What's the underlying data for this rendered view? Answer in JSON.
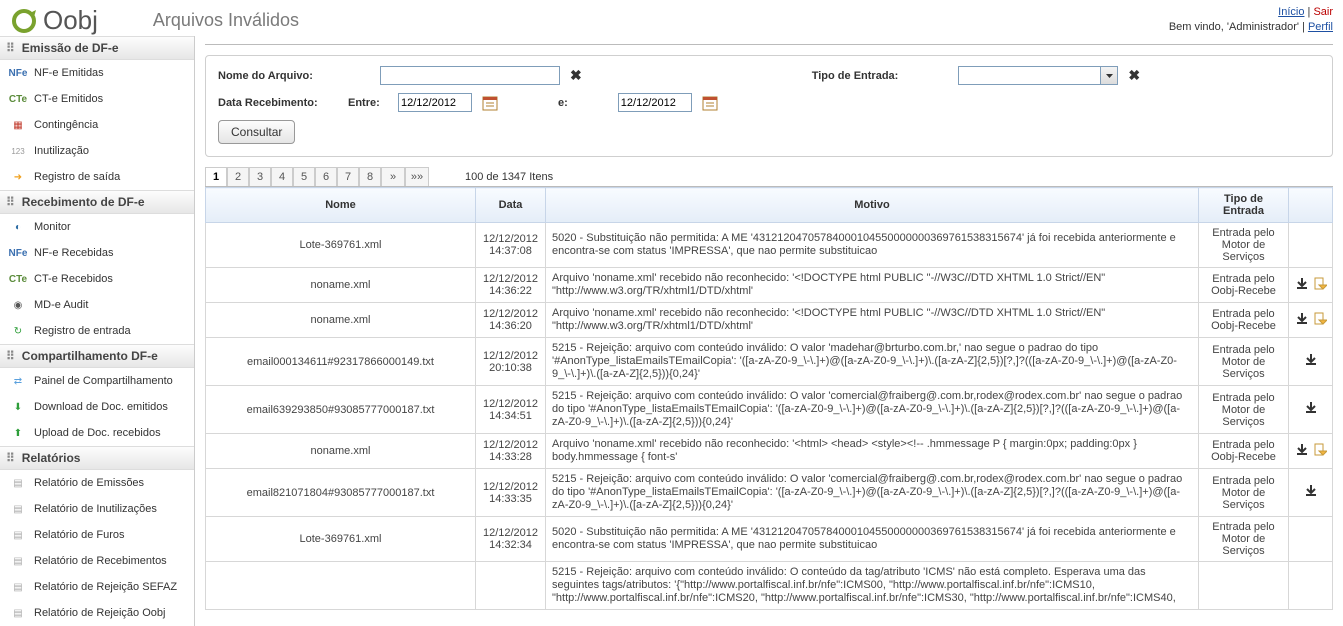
{
  "header": {
    "logo_text": "Oobj",
    "page_title": "Arquivos Inválidos",
    "link_inicio": "Início",
    "link_sair": "Sair",
    "welcome_prefix": "Bem vindo, '",
    "welcome_user": "Administrador",
    "welcome_suffix": "' | ",
    "link_perfil": "Perfil"
  },
  "sidebar": {
    "groups": [
      {
        "title": "Emissão de DF-e",
        "items": [
          {
            "name": "nfe-emitidas",
            "label": "NF-e Emitidas",
            "icon": "NFe",
            "iconColor": "#3a6fb0",
            "iconBold": true
          },
          {
            "name": "cte-emitidos",
            "label": "CT-e Emitidos",
            "icon": "CTe",
            "iconColor": "#5a8b3a",
            "iconBold": true
          },
          {
            "name": "contingencia",
            "label": "Contingência",
            "icon": "▦",
            "iconColor": "#c0392b"
          },
          {
            "name": "inutilizacao",
            "label": "Inutilização",
            "icon": "123",
            "iconColor": "#999",
            "iconSize": "8px"
          },
          {
            "name": "registro-saida",
            "label": "Registro de saída",
            "icon": "➜",
            "iconColor": "#f0a11f"
          }
        ]
      },
      {
        "title": "Recebimento de DF-e",
        "items": [
          {
            "name": "monitor",
            "label": "Monitor",
            "icon": "◐",
            "iconColor": "#2e6da4"
          },
          {
            "name": "nfe-recebidas",
            "label": "NF-e Recebidas",
            "icon": "NFe",
            "iconColor": "#3a6fb0",
            "iconBold": true
          },
          {
            "name": "cte-recebidos",
            "label": "CT-e Recebidos",
            "icon": "CTe",
            "iconColor": "#5a8b3a",
            "iconBold": true
          },
          {
            "name": "mde-audit",
            "label": "MD-e Audit",
            "icon": "◉",
            "iconColor": "#555"
          },
          {
            "name": "registro-entrada",
            "label": "Registro de entrada",
            "icon": "↻",
            "iconColor": "#2e9e3a"
          }
        ]
      },
      {
        "title": "Compartilhamento DF-e",
        "items": [
          {
            "name": "painel-compart",
            "label": "Painel de Compartilhamento",
            "icon": "⇄",
            "iconColor": "#5aa0dd"
          },
          {
            "name": "download-doc",
            "label": "Download de Doc. emitidos",
            "icon": "⬇",
            "iconColor": "#2e9e3a"
          },
          {
            "name": "upload-doc",
            "label": "Upload de Doc. recebidos",
            "icon": "⬆",
            "iconColor": "#2e9e3a"
          }
        ]
      },
      {
        "title": "Relatórios",
        "items": [
          {
            "name": "rel-emissoes",
            "label": "Relatório de Emissões",
            "icon": "▤",
            "iconColor": "#aaa"
          },
          {
            "name": "rel-inutil",
            "label": "Relatório de Inutilizações",
            "icon": "▤",
            "iconColor": "#aaa"
          },
          {
            "name": "rel-furos",
            "label": "Relatório de Furos",
            "icon": "▤",
            "iconColor": "#aaa"
          },
          {
            "name": "rel-recebimentos",
            "label": "Relatório de Recebimentos",
            "icon": "▤",
            "iconColor": "#aaa"
          },
          {
            "name": "rel-rej-sefaz",
            "label": "Relatório de Rejeição SEFAZ",
            "icon": "▤",
            "iconColor": "#aaa"
          },
          {
            "name": "rel-rej-oobj",
            "label": "Relatório de Rejeição Oobj",
            "icon": "▤",
            "iconColor": "#aaa"
          }
        ]
      }
    ]
  },
  "filters": {
    "nome_label": "Nome do Arquivo:",
    "nome_value": "",
    "tipo_label": "Tipo de Entrada:",
    "tipo_value": "",
    "data_label": "Data Recebimento:",
    "entre_label": "Entre:",
    "entre_value": "12/12/2012",
    "e_label": "e:",
    "e_value": "12/12/2012",
    "consultar": "Consultar"
  },
  "pager": {
    "pages": [
      "1",
      "2",
      "3",
      "4",
      "5",
      "6",
      "7",
      "8"
    ],
    "next": "»",
    "last": "»»",
    "info": "100 de 1347 Itens"
  },
  "table": {
    "headers": {
      "nome": "Nome",
      "data": "Data",
      "motivo": "Motivo",
      "tipo": "Tipo de Entrada",
      "act": ""
    },
    "rows": [
      {
        "nome": "Lote-369761.xml",
        "data": "12/12/2012 14:37:08",
        "motivo": "5020 - Substituição não permitida: A ME '43121204705784000104550000000369761538315674' já foi recebida anteriormente e encontra-se com status 'IMPRESSA', que nao permite substituicao",
        "tipo": "Entrada pelo Motor de Serviços",
        "actions": []
      },
      {
        "nome": "noname.xml",
        "data": "12/12/2012 14:36:22",
        "motivo": "Arquivo 'noname.xml' recebido não reconhecido: '<!DOCTYPE html PUBLIC \"-//W3C//DTD XHTML 1.0 Strict//EN\" \"http://www.w3.org/TR/xhtml1/DTD/xhtml'",
        "tipo": "Entrada pelo Oobj-Recebe",
        "actions": [
          "download",
          "warn"
        ]
      },
      {
        "nome": "noname.xml",
        "data": "12/12/2012 14:36:20",
        "motivo": "Arquivo 'noname.xml' recebido não reconhecido: '<!DOCTYPE html PUBLIC \"-//W3C//DTD XHTML 1.0 Strict//EN\" \"http://www.w3.org/TR/xhtml1/DTD/xhtml'",
        "tipo": "Entrada pelo Oobj-Recebe",
        "actions": [
          "download",
          "warn"
        ]
      },
      {
        "nome": "email000134611#92317866000149.txt",
        "data": "12/12/2012 20:10:38",
        "motivo": "5215 - Rejeição: arquivo com conteúdo inválido: O valor 'madehar@brturbo.com.br,' nao segue o padrao do tipo '#AnonType_listaEmailsTEmailCopia': '([a-zA-Z0-9_\\-\\.]+)@([a-zA-Z0-9_\\-\\.]+)\\.([a-zA-Z]{2,5})[?,]?(([a-zA-Z0-9_\\-\\.]+)@([a-zA-Z0-9_\\-\\.]+)\\.([a-zA-Z]{2,5})){0,24}'",
        "tipo": "Entrada pelo Motor de Serviços",
        "actions": [
          "download"
        ]
      },
      {
        "nome": "email639293850#93085777000187.txt",
        "data": "12/12/2012 14:34:51",
        "motivo": "5215 - Rejeição: arquivo com conteúdo inválido: O valor 'comercial@fraiberg@.com.br,rodex@rodex.com.br' nao segue o padrao do tipo '#AnonType_listaEmailsTEmailCopia': '([a-zA-Z0-9_\\-\\.]+)@([a-zA-Z0-9_\\-\\.]+)\\.([a-zA-Z]{2,5})[?,]?(([a-zA-Z0-9_\\-\\.]+)@([a-zA-Z0-9_\\-\\.]+)\\.([a-zA-Z]{2,5})){0,24}'",
        "tipo": "Entrada pelo Motor de Serviços",
        "actions": [
          "download"
        ]
      },
      {
        "nome": "noname.xml",
        "data": "12/12/2012 14:33:28",
        "motivo": "Arquivo 'noname.xml' recebido não reconhecido: '<html> <head> <style><!-- .hmmessage P { margin:0px; padding:0px } body.hmmessage { font-s'",
        "tipo": "Entrada pelo Oobj-Recebe",
        "actions": [
          "download",
          "warn"
        ]
      },
      {
        "nome": "email821071804#93085777000187.txt",
        "data": "12/12/2012 14:33:35",
        "motivo": "5215 - Rejeição: arquivo com conteúdo inválido: O valor 'comercial@fraiberg@.com.br,rodex@rodex.com.br' nao segue o padrao do tipo '#AnonType_listaEmailsTEmailCopia': '([a-zA-Z0-9_\\-\\.]+)@([a-zA-Z0-9_\\-\\.]+)\\.([a-zA-Z]{2,5})[?,]?(([a-zA-Z0-9_\\-\\.]+)@([a-zA-Z0-9_\\-\\.]+)\\.([a-zA-Z]{2,5})){0,24}'",
        "tipo": "Entrada pelo Motor de Serviços",
        "actions": [
          "download"
        ]
      },
      {
        "nome": "Lote-369761.xml",
        "data": "12/12/2012 14:32:34",
        "motivo": "5020 - Substituição não permitida: A ME '43121204705784000104550000000369761538315674' já foi recebida anteriormente e encontra-se com status 'IMPRESSA', que nao permite substituicao",
        "tipo": "Entrada pelo Motor de Serviços",
        "actions": []
      },
      {
        "nome": "",
        "data": "",
        "motivo": "5215 - Rejeição: arquivo com conteúdo inválido: O conteúdo da tag/atributo 'ICMS' não está completo. Esperava uma das seguintes tags/atributos: '{\"http://www.portalfiscal.inf.br/nfe\":ICMS00, \"http://www.portalfiscal.inf.br/nfe\":ICMS10, \"http://www.portalfiscal.inf.br/nfe\":ICMS20, \"http://www.portalfiscal.inf.br/nfe\":ICMS30, \"http://www.portalfiscal.inf.br/nfe\":ICMS40,",
        "tipo": "",
        "actions": []
      }
    ]
  }
}
